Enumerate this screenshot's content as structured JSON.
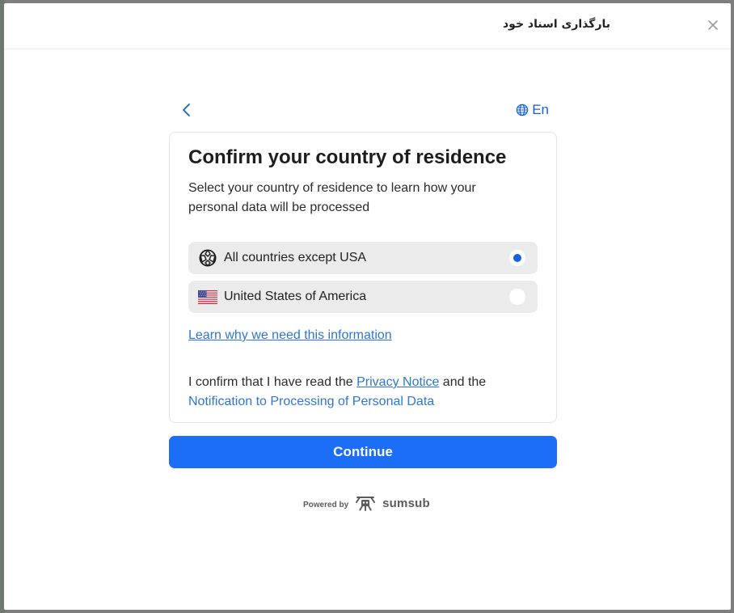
{
  "modal": {
    "title": "بارگذاری اسناد خود",
    "close_icon": "close-icon"
  },
  "nav": {
    "back_icon": "chevron-left-icon",
    "language_icon": "globe-icon",
    "language_label": "En"
  },
  "card": {
    "title": "Confirm your country of residence",
    "subtitle": "Select your country of residence to learn how your personal data will be processed",
    "options": [
      {
        "label": "All countries except USA",
        "icon": "globe-grid-icon",
        "selected": true
      },
      {
        "label": "United States of America",
        "icon": "us-flag-icon",
        "selected": false
      }
    ],
    "learn_link": "Learn why we need this information",
    "consent": {
      "prefix": "I confirm that I have read the ",
      "privacy_link": "Privacy Notice",
      "middle": " and the",
      "notification_link": "Notification to Processing of Personal Data"
    }
  },
  "continue_label": "Continue",
  "footer": {
    "powered_by": "Powered by",
    "brand": "sumsub",
    "brand_icon": "sumsub-logo-icon"
  },
  "colors": {
    "accent": "#1b6ef5",
    "link": "#2f76cf",
    "option_bg": "#ebebeb",
    "radio_selected": "#1662dd"
  }
}
